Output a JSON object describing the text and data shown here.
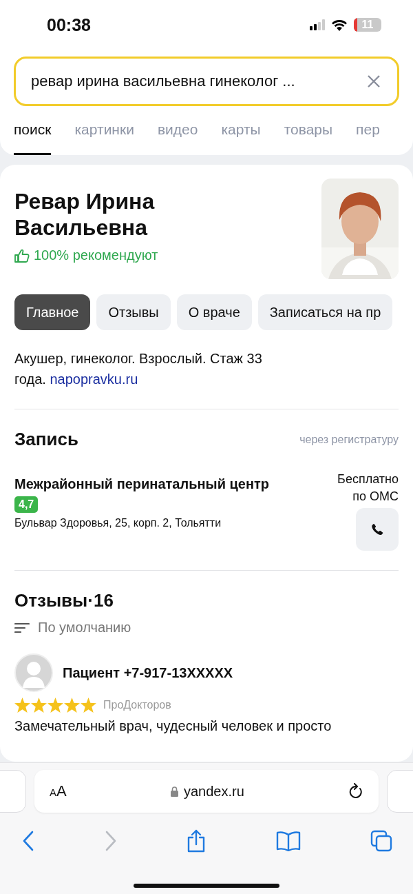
{
  "status_bar": {
    "time": "00:38",
    "battery": "11"
  },
  "search": {
    "value": "ревар ирина васильевна гинеколог ..."
  },
  "tabs": [
    {
      "label": "поиск",
      "selected": true
    },
    {
      "label": "картинки",
      "selected": false
    },
    {
      "label": "видео",
      "selected": false
    },
    {
      "label": "карты",
      "selected": false
    },
    {
      "label": "товары",
      "selected": false
    },
    {
      "label": "пер",
      "selected": false
    }
  ],
  "doctor": {
    "name": "Ревар Ирина Васильевна",
    "recommend": "100% рекомендуют"
  },
  "sections": [
    {
      "label": "Главное",
      "selected": true
    },
    {
      "label": "Отзывы",
      "selected": false
    },
    {
      "label": "О враче",
      "selected": false
    },
    {
      "label": "Записаться на пр",
      "selected": false
    }
  ],
  "description": "Акушер, гинеколог. Взрослый. Стаж 33 года.",
  "source_link": "napopravku.ru",
  "booking": {
    "title": "Запись",
    "via": "через регистратуру",
    "clinic": "Межрайонный перинатальный центр",
    "rating": "4,7",
    "address": "Бульвар Здоровья, 25, корп. 2, Тольятти",
    "price": "Бесплатно по ОМС"
  },
  "reviews": {
    "title": "Отзывы",
    "separator": "·",
    "count": "16",
    "sort": "По умолчанию",
    "items": [
      {
        "author": "Пациент +7-917-13XXXXX",
        "stars": 5,
        "source": "ПроДокторов",
        "text": "Замечательный врач, чудесный человек и просто"
      }
    ]
  },
  "browser": {
    "text_size": "AA",
    "url": "yandex.ru",
    "nav": [
      {
        "kind": "back",
        "disabled": false
      },
      {
        "kind": "forward",
        "disabled": true
      },
      {
        "kind": "share",
        "disabled": false
      },
      {
        "kind": "bookmarks",
        "disabled": false
      },
      {
        "kind": "tabs",
        "disabled": false
      }
    ]
  }
}
